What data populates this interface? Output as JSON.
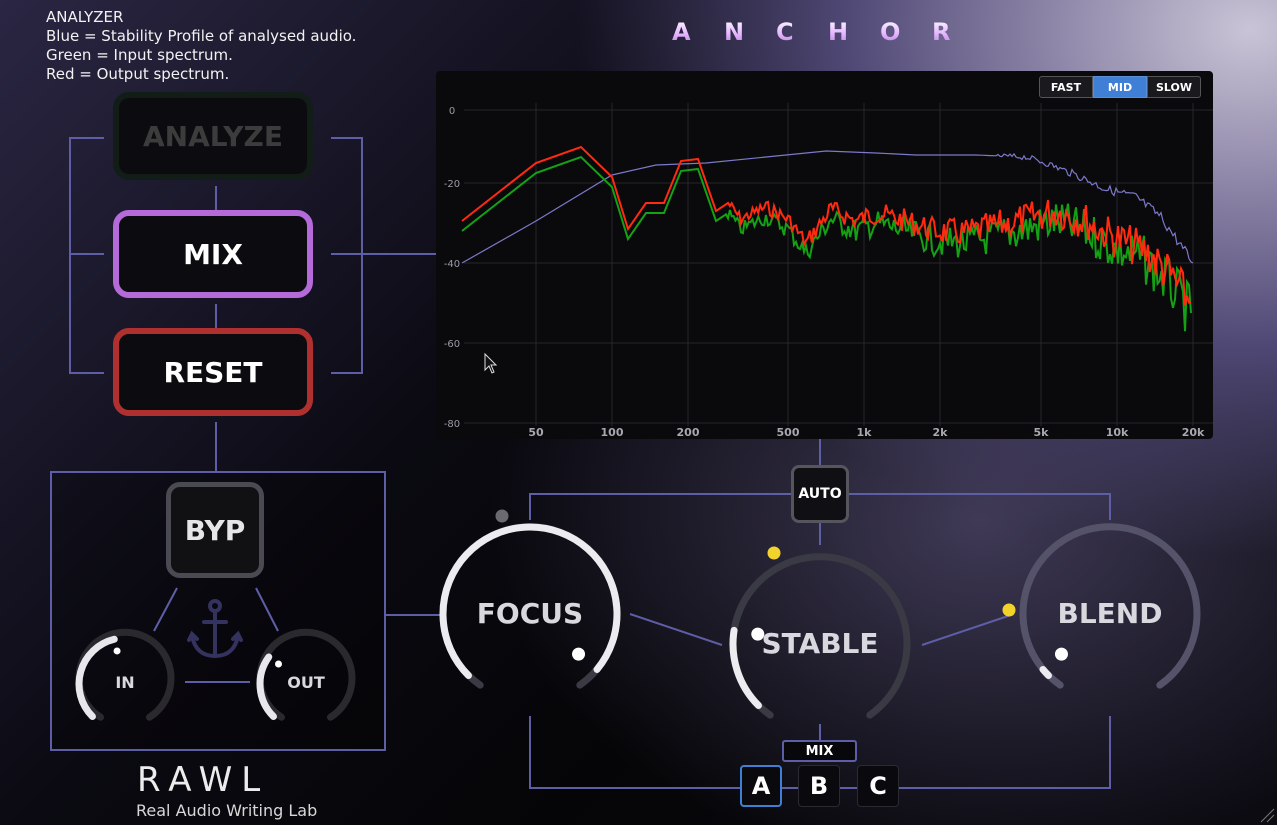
{
  "info": {
    "heading": "ANALYZER",
    "lines": [
      "Blue = Stability Profile of analysed audio.",
      "Green = Input spectrum.",
      "Red = Output spectrum."
    ]
  },
  "title": [
    "A",
    "N",
    "C",
    "H",
    "O",
    "R"
  ],
  "buttons": {
    "analyze": "ANALYZE",
    "mix": "MIX",
    "reset": "RESET",
    "bypass": "BYP",
    "auto": "AUTO"
  },
  "analyzer": {
    "speed_options": [
      "FAST",
      "MID",
      "SLOW"
    ],
    "selected_speed": "MID",
    "y_ticks": [
      "0",
      "-20",
      "-40",
      "-60",
      "-80"
    ],
    "x_ticks": [
      "50",
      "100",
      "200",
      "500",
      "1k",
      "2k",
      "5k",
      "10k",
      "20k"
    ]
  },
  "knobs": {
    "in": {
      "label": "IN",
      "value": 0.45
    },
    "out": {
      "label": "OUT",
      "value": 0.3
    },
    "focus": {
      "label": "FOCUS",
      "value": 0.98
    },
    "stable": {
      "label": "STABLE",
      "value": 0.2
    },
    "blend": {
      "label": "BLEND",
      "value": 0.02
    }
  },
  "mix_selector": {
    "label": "MIX",
    "slots": [
      "A",
      "B",
      "C"
    ],
    "selected": "A"
  },
  "logo": {
    "name": "RAWL",
    "tagline": "Real Audio Writing Lab"
  },
  "colors": {
    "mix": "#b46ad9",
    "reset": "#b03030",
    "wire": "#5e5ea6",
    "selected": "#3f7fd6",
    "indicator": "#f2d32c"
  }
}
